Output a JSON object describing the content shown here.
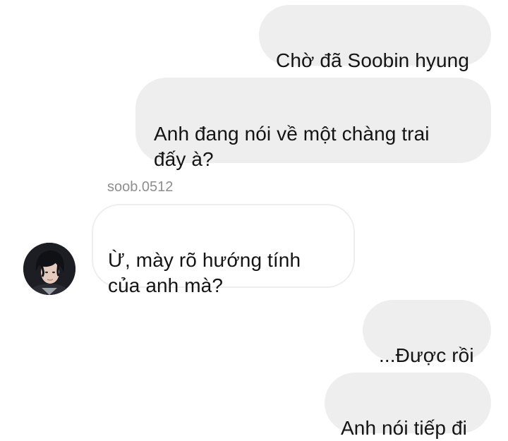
{
  "messages": [
    {
      "side": "sent",
      "text": "Chờ đã Soobin hyung"
    },
    {
      "side": "sent",
      "text": "Anh đang nói về một chàng trai\nđấy à?"
    },
    {
      "side": "received",
      "sender": "soob.0512",
      "text": "Ừ, mày rõ hướng tính\ncủa anh mà?"
    },
    {
      "side": "sent",
      "text": "...Được rồi"
    },
    {
      "side": "sent",
      "text": "Anh nói tiếp đi"
    }
  ],
  "colors": {
    "sent_bubble": "#eeeeef",
    "received_border": "#eeeeef",
    "text": "#141414",
    "username": "#8e8e8e"
  },
  "icons": {
    "avatar": "profile-photo"
  }
}
